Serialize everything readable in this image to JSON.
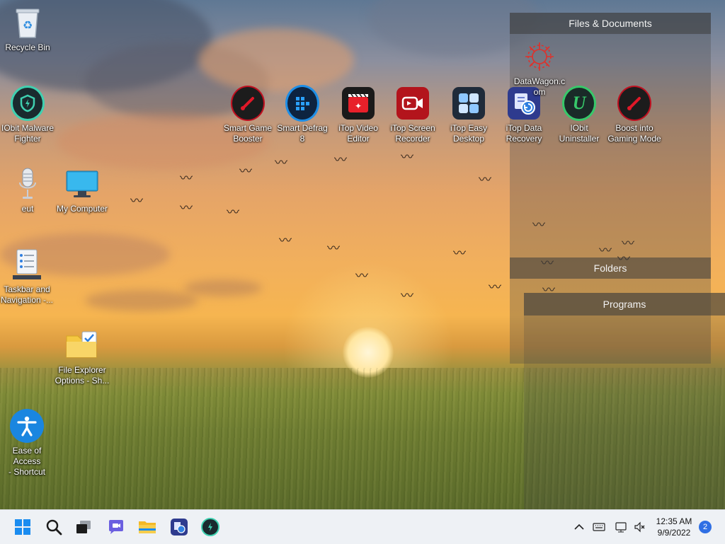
{
  "desktop": {
    "icons": [
      {
        "id": "recycle",
        "label": "Recycle Bin"
      },
      {
        "id": "iobit_malware",
        "label": "IObit Malware\nFighter"
      },
      {
        "id": "eut",
        "label": "eut"
      },
      {
        "id": "my_computer",
        "label": "My Computer"
      },
      {
        "id": "taskbar_nav",
        "label": "Taskbar and\nNavigation -..."
      },
      {
        "id": "file_explorer_opts",
        "label": "File Explorer\nOptions - Sh..."
      },
      {
        "id": "ease_access",
        "label": "Ease of Access\n- Shortcut"
      },
      {
        "id": "smart_game",
        "label": "Smart Game\nBooster"
      },
      {
        "id": "smart_defrag",
        "label": "Smart Defrag\n8"
      },
      {
        "id": "itop_video",
        "label": "iTop Video\nEditor"
      },
      {
        "id": "itop_screen",
        "label": "iTop Screen\nRecorder"
      },
      {
        "id": "itop_easy",
        "label": "iTop Easy\nDesktop"
      },
      {
        "id": "itop_data",
        "label": "iTop Data\nRecovery"
      },
      {
        "id": "iobit_uninst",
        "label": "IObit\nUninstaller"
      },
      {
        "id": "boost_gaming",
        "label": "Boost into\nGaming Mode"
      },
      {
        "id": "datawagon",
        "label": "DataWagon.c\nom"
      }
    ]
  },
  "fences": {
    "files": {
      "title": "Files & Documents"
    },
    "folders": {
      "title": "Folders"
    },
    "programs": {
      "title": "Programs"
    }
  },
  "taskbar": {
    "apps": [
      {
        "icon": "windows-start-icon"
      },
      {
        "icon": "search-icon"
      },
      {
        "icon": "task-view-icon"
      },
      {
        "icon": "chat-icon"
      },
      {
        "icon": "file-explorer-icon"
      },
      {
        "icon": "itop-data-recovery-icon"
      },
      {
        "icon": "iobit-malware-fighter-icon"
      }
    ],
    "clock": {
      "time": "12:35 AM",
      "date": "9/9/2022"
    },
    "notification_count": "2"
  },
  "colors": {
    "accent": "#2f6fe4",
    "taskbar_bg": "#eef1f5"
  }
}
